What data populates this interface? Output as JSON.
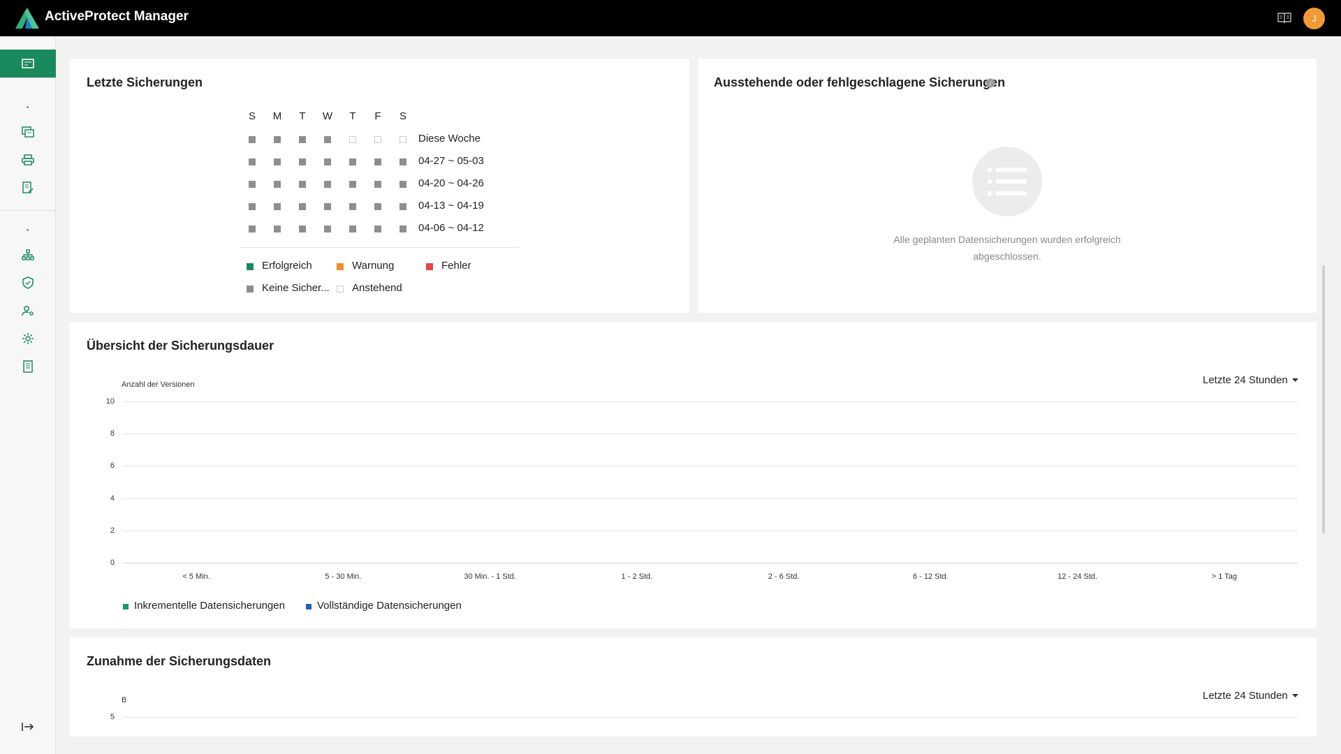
{
  "app": {
    "title": "ActiveProtect Manager",
    "avatar_initial": "J",
    "accent": "#1a8a5e"
  },
  "sidebar": {
    "items": [
      {
        "icon": "dashboard-icon",
        "active": true
      },
      {
        "icon": "storage-icon"
      },
      {
        "icon": "printer-icon"
      },
      {
        "icon": "task-list-icon"
      },
      {
        "icon": "topology-icon"
      },
      {
        "icon": "shield-icon"
      },
      {
        "icon": "user-settings-icon"
      },
      {
        "icon": "gear-icon"
      },
      {
        "icon": "log-icon"
      }
    ],
    "bottom_icon": "logout-icon"
  },
  "recent_backups": {
    "title": "Letzte Sicherungen",
    "days": [
      "S",
      "M",
      "T",
      "W",
      "T",
      "F",
      "S"
    ],
    "rows": [
      {
        "label": "Diese Woche",
        "cells": [
          "none",
          "none",
          "none",
          "none",
          "pending",
          "pending",
          "pending"
        ]
      },
      {
        "label": "04-27 ~ 05-03",
        "cells": [
          "none",
          "none",
          "none",
          "none",
          "none",
          "none",
          "none"
        ]
      },
      {
        "label": "04-20 ~ 04-26",
        "cells": [
          "none",
          "none",
          "none",
          "none",
          "none",
          "none",
          "none"
        ]
      },
      {
        "label": "04-13 ~ 04-19",
        "cells": [
          "none",
          "none",
          "none",
          "none",
          "none",
          "none",
          "none"
        ]
      },
      {
        "label": "04-06 ~ 04-12",
        "cells": [
          "none",
          "none",
          "none",
          "none",
          "none",
          "none",
          "none"
        ]
      }
    ],
    "legend": [
      {
        "label": "Erfolgreich",
        "color": "#1a8a5e"
      },
      {
        "label": "Warnung",
        "color": "#f0902c"
      },
      {
        "label": "Fehler",
        "color": "#e04848"
      },
      {
        "label": "Keine Sicher...",
        "color": "#8e8e8e"
      },
      {
        "label": "Anstehend",
        "color": "#ffffff"
      }
    ]
  },
  "pending_backups": {
    "title": "Ausstehende oder fehlgeschlagene Sicherungen",
    "empty_message_line1": "Alle geplanten Datensicherungen wurden erfolgreich",
    "empty_message_line2": "abgeschlossen."
  },
  "duration_overview": {
    "title": "Übersicht der Sicherungsdauer",
    "range_select": "Letzte 24 Stunden",
    "chart_data": {
      "type": "bar",
      "ylabel": "Anzahl der Versionen",
      "ylim": [
        0,
        10
      ],
      "yticks": [
        "10",
        "8",
        "6",
        "4",
        "2",
        "0"
      ],
      "categories": [
        "< 5 Min.",
        "5 - 30 Min.",
        "30 Min. - 1 Std.",
        "1 - 2 Std.",
        "2 - 6 Std.",
        "6 - 12 Std.",
        "12 - 24 Std.",
        "> 1 Tag"
      ],
      "series": [
        {
          "name": "Inkrementelle Datensicherungen",
          "color": "#1a9a6a",
          "values": [
            0,
            0,
            0,
            0,
            0,
            0,
            0,
            0
          ]
        },
        {
          "name": "Vollständige Datensicherungen",
          "color": "#1a64b4",
          "values": [
            0,
            0,
            0,
            0,
            0,
            0,
            0,
            0
          ]
        }
      ]
    }
  },
  "data_growth": {
    "title": "Zunahme der Sicherungsdaten",
    "range_select": "Letzte 24 Stunden",
    "ylabel": "B",
    "ytick_top": "5"
  }
}
